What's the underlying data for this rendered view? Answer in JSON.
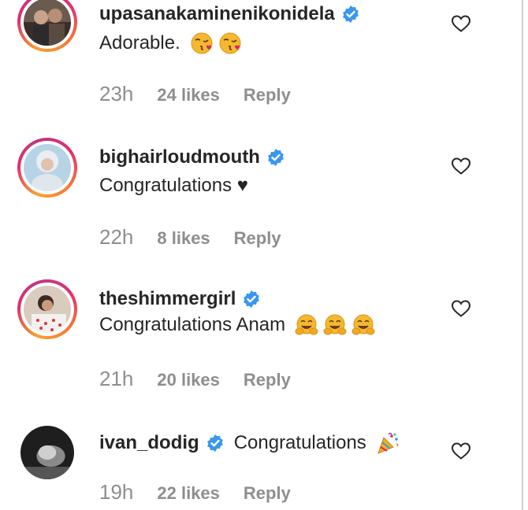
{
  "comments": [
    {
      "username": "upasanakaminenikonidela",
      "verified": true,
      "text": "Adorable.",
      "emojis": [
        "kissing-face-emoji",
        "kissing-face-emoji"
      ],
      "time": "23h",
      "likes": "24 likes",
      "reply": "Reply"
    },
    {
      "username": "bighairloudmouth",
      "verified": true,
      "text": "Congratulations ♥",
      "emojis": [],
      "time": "22h",
      "likes": "8 likes",
      "reply": "Reply"
    },
    {
      "username": "theshimmergirl",
      "verified": true,
      "text": "Congratulations Anam",
      "emojis": [
        "hugging-face-emoji",
        "hugging-face-emoji",
        "hugging-face-emoji"
      ],
      "time": "21h",
      "likes": "20 likes",
      "reply": "Reply"
    },
    {
      "username": "ivan_dodig",
      "verified": true,
      "text": "Congratulations",
      "emojis": [
        "party-popper-emoji"
      ],
      "time": "19h",
      "likes": "22 likes",
      "reply": "Reply"
    }
  ],
  "colors": {
    "text": "#262626",
    "muted": "#8e8e8e",
    "verified": "#3897f0"
  }
}
